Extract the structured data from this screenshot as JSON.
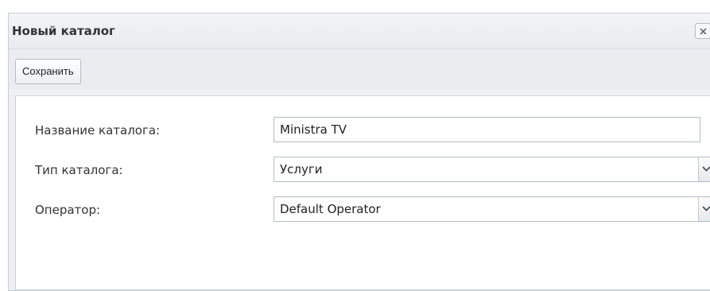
{
  "dialog": {
    "title": "Новый каталог",
    "close_icon": "close-icon"
  },
  "toolbar": {
    "save_label": "Сохранить"
  },
  "form": {
    "name_label": "Название каталога:",
    "name_value": "Ministra TV",
    "type_label": "Тип каталога:",
    "type_value": "Услуги",
    "operator_label": "Оператор:",
    "operator_value": "Default Operator",
    "dropdown_icon": "chevron-down-icon"
  },
  "colors": {
    "dialog_background": "#eff0f2",
    "panel_background": "#ffffff",
    "border": "#b5bcc6",
    "text": "#333333"
  }
}
